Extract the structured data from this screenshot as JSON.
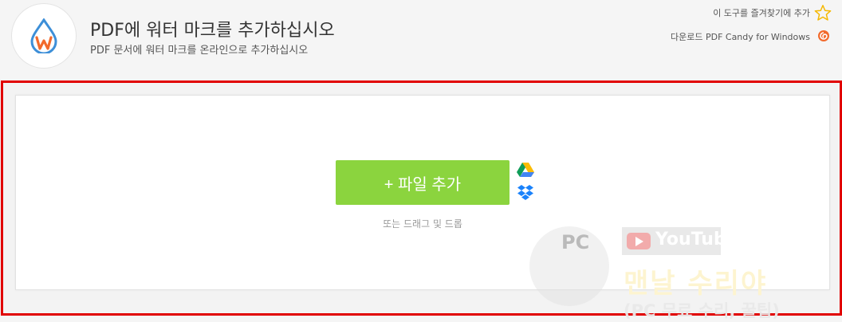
{
  "header": {
    "title": "PDF에 워터 마크를 추가하십시오",
    "subtitle": "PDF 문서에 워터 마크를 온라인으로 추가하십시오",
    "favorite_label": "이 도구를 즐겨찾기에 추가",
    "download_label": "다운로드 PDF Candy for Windows"
  },
  "main": {
    "add_file_label": "+ 파일 추가",
    "drag_hint": "또는 드래그 및 드롭"
  },
  "watermark": {
    "pc_text": "PC",
    "youtube_text": "YouTube",
    "line1": "맨날 수리야",
    "line2": "(PC 무료 수리, 꿀팁)"
  },
  "colors": {
    "accent_green": "#8bd43e",
    "highlight_border": "#e10000",
    "logo_blue": "#3d8fd8",
    "logo_orange": "#f26a2c"
  }
}
